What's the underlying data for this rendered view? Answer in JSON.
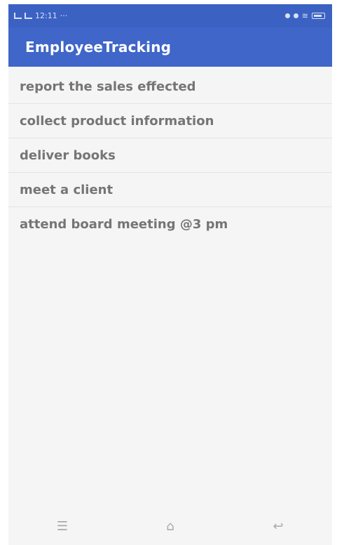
{
  "status_bar": {
    "time": "12:11",
    "extra": "···"
  },
  "app_bar": {
    "title": "EmployeeTracking"
  },
  "tasks": [
    {
      "label": "report the sales effected"
    },
    {
      "label": "collect product information"
    },
    {
      "label": "deliver books"
    },
    {
      "label": "meet a client"
    },
    {
      "label": "attend board meeting @3 pm"
    }
  ],
  "icons": {
    "signal": "signal-icon",
    "location": "location-icon",
    "sync": "sync-icon",
    "wifi": "wifi-icon",
    "battery": "battery-icon",
    "menu": "menu-icon",
    "home": "home-icon",
    "back": "back-icon"
  },
  "colors": {
    "primary": "#3f66c8",
    "status_bar": "#3b62c3",
    "list_background": "#f5f5f5",
    "item_text": "#757575",
    "divider": "#e3e3e3",
    "nav_icon": "#a9a9a9"
  }
}
